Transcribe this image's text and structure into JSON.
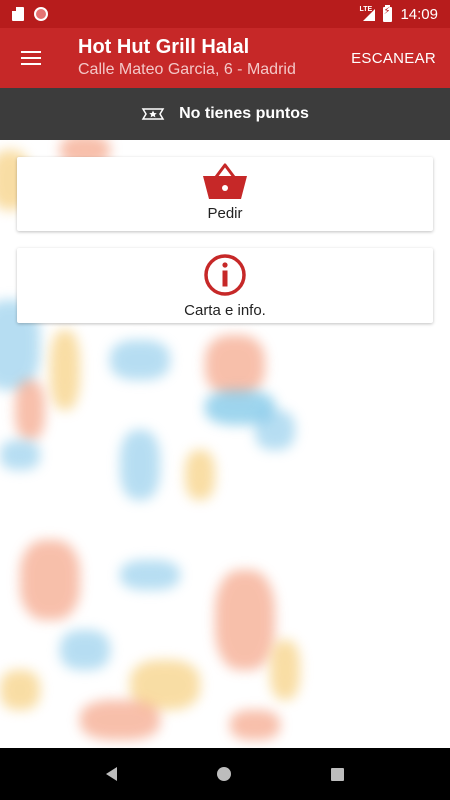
{
  "status_bar": {
    "time": "14:09",
    "network_label": "LTE"
  },
  "app_bar": {
    "title": "Hot Hut Grill Halal",
    "subtitle": "Calle Mateo Garcia, 6 - Madrid",
    "scan_label": "ESCANEAR"
  },
  "points": {
    "label": "No tienes puntos"
  },
  "cards": [
    {
      "label": "Pedir",
      "icon": "basket-icon"
    },
    {
      "label": "Carta e info.",
      "icon": "info-icon"
    }
  ],
  "colors": {
    "status_bar": "#b71c1c",
    "app_bar": "#c62828",
    "points_bar": "#3c3c3c",
    "accent": "#c62828",
    "nav_bar": "#000000"
  }
}
